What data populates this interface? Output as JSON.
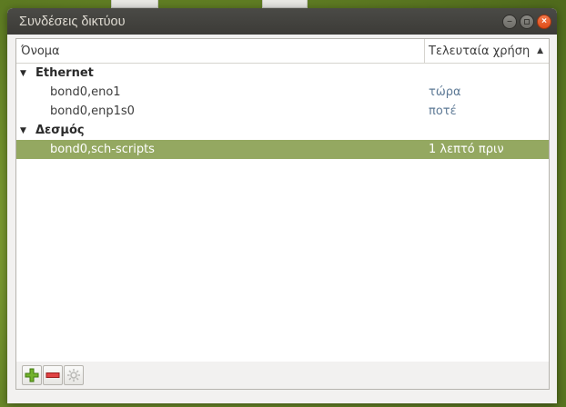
{
  "window": {
    "title": "Συνδέσεις δικτύου",
    "controls": [
      "minimize",
      "maximize",
      "close"
    ]
  },
  "table": {
    "columns": [
      {
        "label": "Όνομα"
      },
      {
        "label": "Τελευταία χρήση",
        "sort": "ascending"
      }
    ],
    "groups": [
      {
        "label": "Ethernet",
        "expanded": true,
        "items": [
          {
            "name": "bond0,eno1",
            "last_used": "τώρα",
            "selected": false
          },
          {
            "name": "bond0,enp1s0",
            "last_used": "ποτέ",
            "selected": false
          }
        ]
      },
      {
        "label": "Δεσμός",
        "expanded": true,
        "items": [
          {
            "name": "bond0,sch-scripts",
            "last_used": "1 λεπτό πριν",
            "selected": true
          }
        ]
      }
    ]
  },
  "toolbar": {
    "buttons": [
      {
        "icon": "plus-icon",
        "enabled": true
      },
      {
        "icon": "minus-icon",
        "enabled": true
      },
      {
        "icon": "gear-icon",
        "enabled": false
      }
    ]
  },
  "colors": {
    "selection": "#94a861",
    "link_text": "#5e7a96",
    "titlebar": "#3c3b37",
    "close_button": "#df4b16"
  }
}
